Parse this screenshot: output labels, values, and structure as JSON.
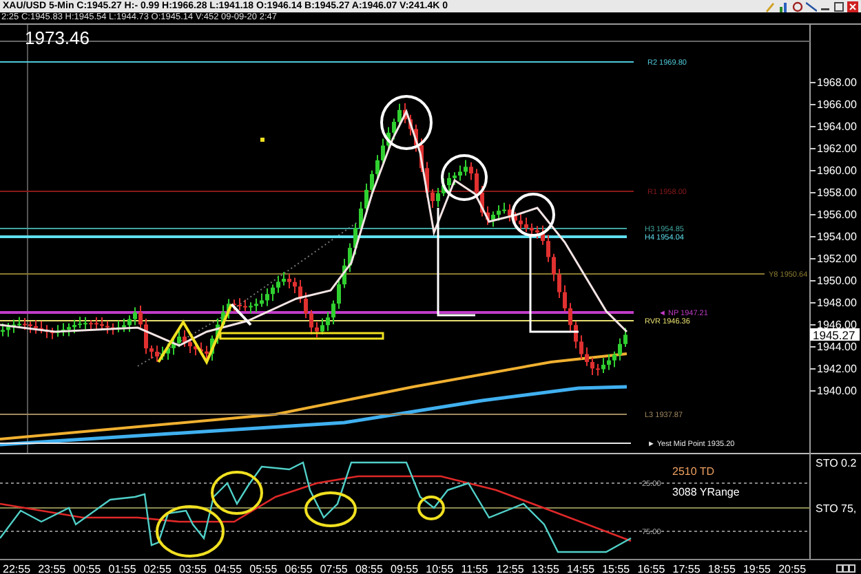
{
  "header": {
    "title": "XAU/USD 5-Min C:1945.27 H:- 0.99 H:1966.28 L:1941.18 O:1946.14 B:1945.27 A:1946.07 V:241.4K 0"
  },
  "info_line": "2:25 C:1945.83 H:1945.54 L:1944.73 O:1945.14 V:452 09-09-20 2:47",
  "main_pane": {
    "high_label": "1973.46",
    "price_ticks": [
      "1968.00",
      "1966.00",
      "1964.00",
      "1962.00",
      "1960.00",
      "1958.00",
      "1956.00",
      "1954.00",
      "1952.00",
      "1950.00",
      "1948.00",
      "1946.00",
      "1944.00",
      "1942.00",
      "1940.00"
    ],
    "current_price": "1945.27",
    "levels": [
      {
        "label": "R2 1969.80",
        "color": "#4fc8d8"
      },
      {
        "label": "R1 1958.00",
        "color": "#8b1a1a"
      },
      {
        "label": "H3 1954.85",
        "color": "#3fa6a0"
      },
      {
        "label": "H4 1954.04",
        "color": "#5ee0f0"
      },
      {
        "label": "Y8 1950.64",
        "color": "#8a7a30"
      },
      {
        "label": "◄ NP 1947.21",
        "color": "#c03cc8"
      },
      {
        "label": "RVR 1946.36",
        "color": "#e8e070"
      },
      {
        "label": "L3 1937.87",
        "color": "#a08860"
      },
      {
        "label": "► Yest Mid Point 1935.20",
        "color": "#e8e8e8"
      }
    ]
  },
  "indicator_pane": {
    "grid_labels": [
      "25.00",
      "75.00"
    ],
    "legend": [
      {
        "label": "2510 TD",
        "color": "#f0a060"
      },
      {
        "label": "3088 YRange",
        "color": "#ffffff"
      }
    ],
    "axis_labels": [
      "STO 0.2",
      "STO 75,"
    ]
  },
  "time_axis": [
    "22:55",
    "23:55",
    "00:55",
    "01:55",
    "02:55",
    "03:55",
    "04:55",
    "05:55",
    "06:55",
    "07:55",
    "08:55",
    "09:55",
    "10:55",
    "11:55",
    "12:55",
    "13:55",
    "14:55",
    "15:55",
    "16:55",
    "17:55",
    "18:55",
    "19:55",
    "20:55"
  ]
}
